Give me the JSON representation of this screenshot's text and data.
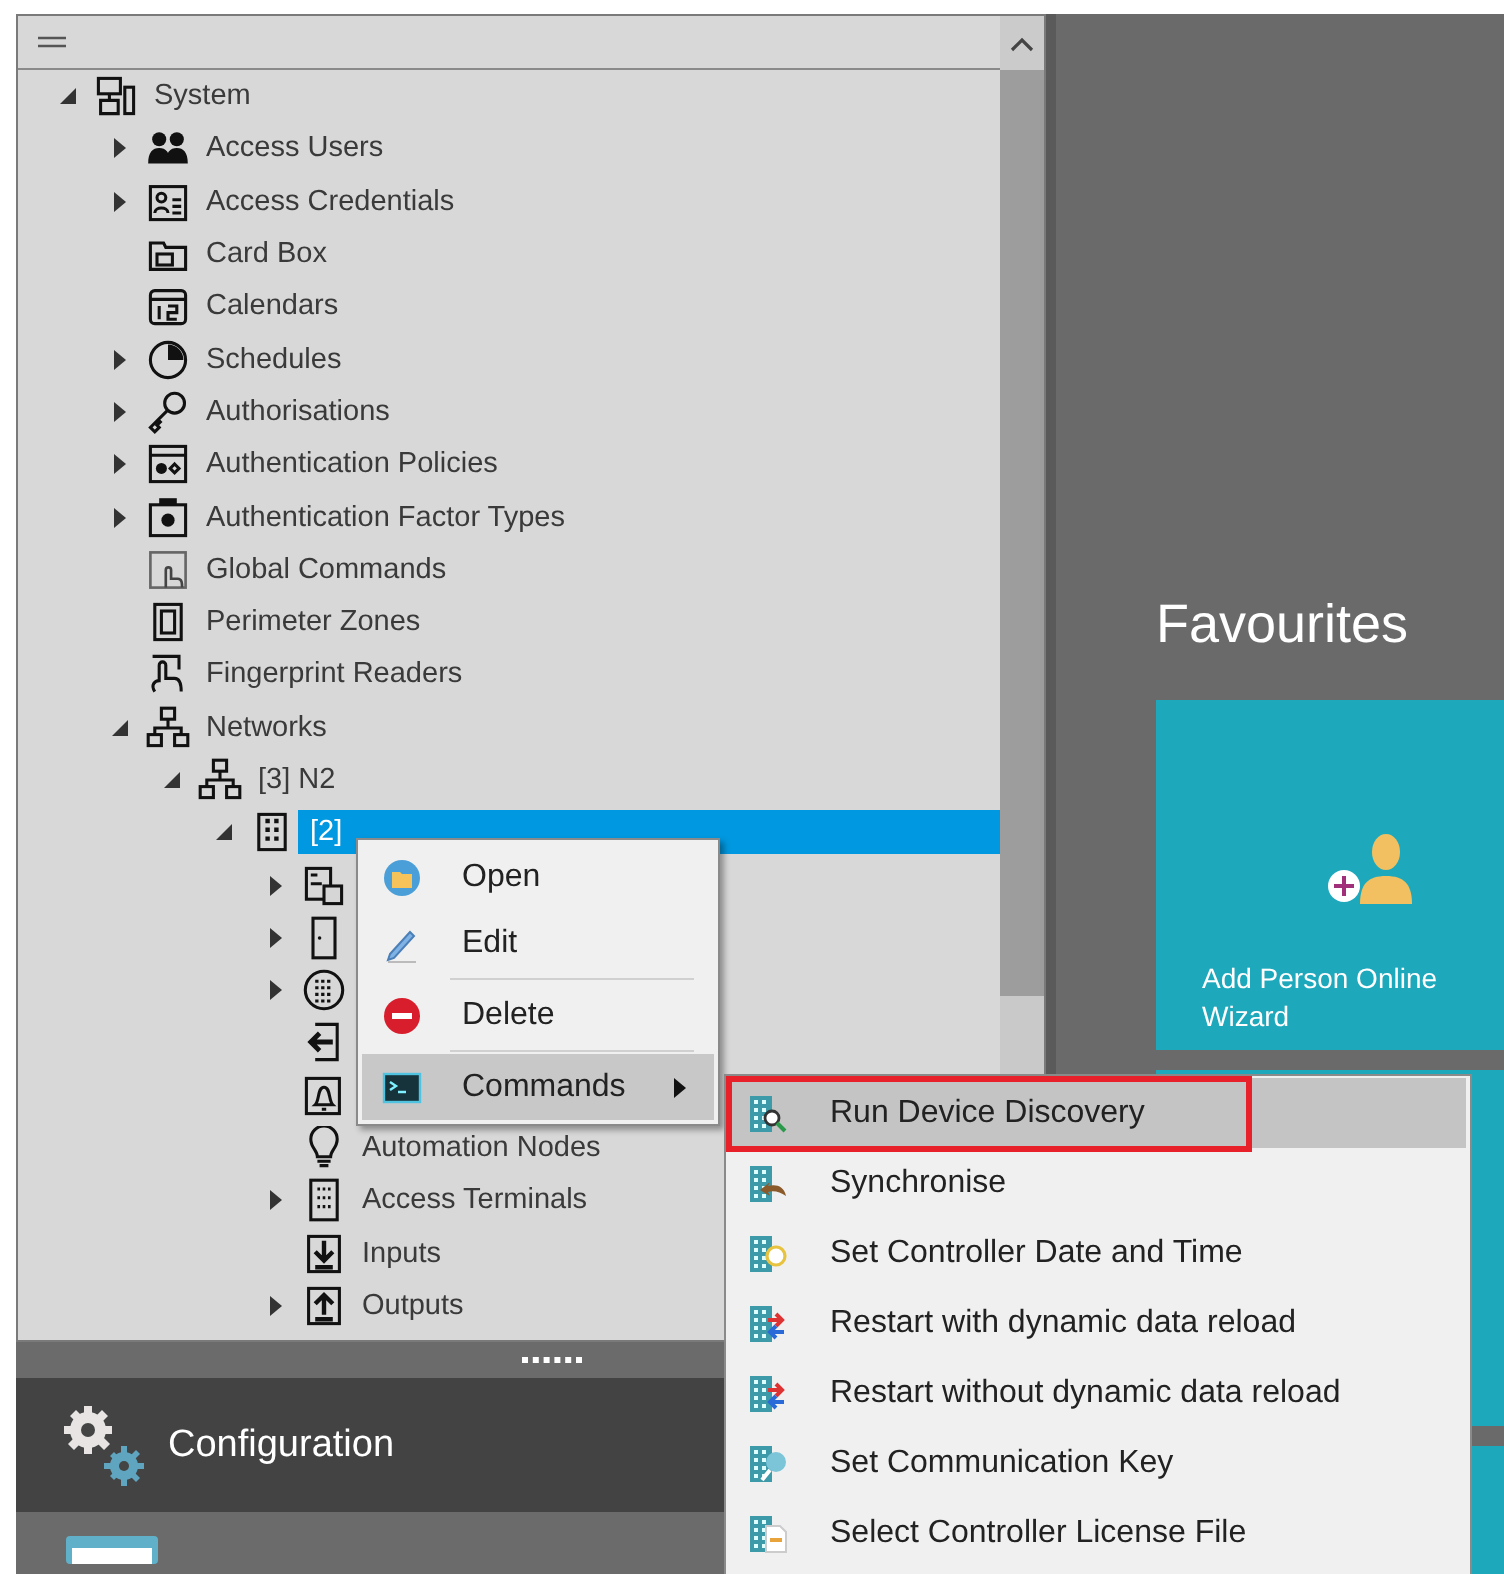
{
  "tree_panel": {
    "tree": [
      {
        "label": "System",
        "kind": "system",
        "expanded": true,
        "selected": false,
        "children": [
          {
            "label": "Access Users",
            "kind": "users",
            "expanded": false,
            "selected": false
          },
          {
            "label": "Access Credentials",
            "kind": "credential",
            "expanded": false,
            "selected": false
          },
          {
            "label": "Card Box",
            "kind": "cardbox",
            "selected": false
          },
          {
            "label": "Calendars",
            "kind": "calendar",
            "selected": false
          },
          {
            "label": "Schedules",
            "kind": "schedule",
            "expanded": false,
            "selected": false
          },
          {
            "label": "Authorisations",
            "kind": "key",
            "expanded": false,
            "selected": false
          },
          {
            "label": "Authentication Policies",
            "kind": "policy",
            "expanded": false,
            "selected": false
          },
          {
            "label": "Authentication Factor Types",
            "kind": "factor",
            "expanded": false,
            "selected": false
          },
          {
            "label": "Global Commands",
            "kind": "command",
            "selected": false
          },
          {
            "label": "Perimeter Zones",
            "kind": "zone",
            "selected": false
          },
          {
            "label": "Fingerprint Readers",
            "kind": "fingerprint",
            "selected": false
          },
          {
            "label": "Networks",
            "kind": "network",
            "expanded": true,
            "selected": false,
            "children": [
              {
                "label": "[3] N2",
                "kind": "network",
                "expanded": true,
                "selected": false,
                "children": [
                  {
                    "label": "[2]",
                    "kind": "controller",
                    "expanded": true,
                    "selected": true,
                    "children": [
                      {
                        "kind": "modules",
                        "expanded": false,
                        "selected": false
                      },
                      {
                        "kind": "door",
                        "expanded": false,
                        "selected": false
                      },
                      {
                        "kind": "keypad",
                        "expanded": false,
                        "selected": false
                      },
                      {
                        "kind": "entry",
                        "selected": false
                      },
                      {
                        "kind": "alarm",
                        "selected": false
                      },
                      {
                        "label": "Automation Nodes",
                        "kind": "bulb",
                        "selected": false
                      },
                      {
                        "label": "Access Terminals",
                        "kind": "terminal",
                        "expanded": false,
                        "selected": false
                      },
                      {
                        "label": "Inputs",
                        "kind": "input",
                        "selected": false
                      },
                      {
                        "label": "Outputs",
                        "kind": "output",
                        "expanded": false,
                        "selected": false
                      }
                    ]
                  }
                ]
              }
            ]
          }
        ]
      }
    ]
  },
  "nav": [
    {
      "label": "Configuration",
      "kind": "configuration"
    }
  ],
  "favourites": {
    "title": "Favourites",
    "tiles": [
      {
        "label": "Add Person Online Wizard",
        "kind": "person_add"
      },
      {
        "kind": "blank"
      },
      {
        "kind": "blank"
      }
    ]
  },
  "context_menu": {
    "items": [
      {
        "label": "Open",
        "kind": "open",
        "selected": false,
        "submenu": false
      },
      {
        "label": "Edit",
        "kind": "edit",
        "selected": false,
        "submenu": false
      },
      {
        "label": "Delete",
        "kind": "delete",
        "selected": false,
        "submenu": false
      },
      {
        "label": "Commands",
        "kind": "commands",
        "selected": true,
        "submenu": true
      }
    ]
  },
  "submenu": {
    "items": [
      {
        "label": "Run Device Discovery",
        "kind": "discovery",
        "selected": true,
        "outlined": true
      },
      {
        "label": "Synchronise",
        "kind": "sync",
        "selected": false,
        "outlined": false
      },
      {
        "label": "Set Controller Date and Time",
        "kind": "time",
        "selected": false,
        "outlined": false
      },
      {
        "label": "Restart with dynamic data reload",
        "kind": "restart",
        "selected": false,
        "outlined": false
      },
      {
        "label": "Restart without dynamic data reload",
        "kind": "restart",
        "selected": false,
        "outlined": false
      },
      {
        "label": "Set Communication Key",
        "kind": "key",
        "selected": false,
        "outlined": false
      },
      {
        "label": "Select Controller License File",
        "kind": "license",
        "selected": false,
        "outlined": false
      }
    ]
  }
}
